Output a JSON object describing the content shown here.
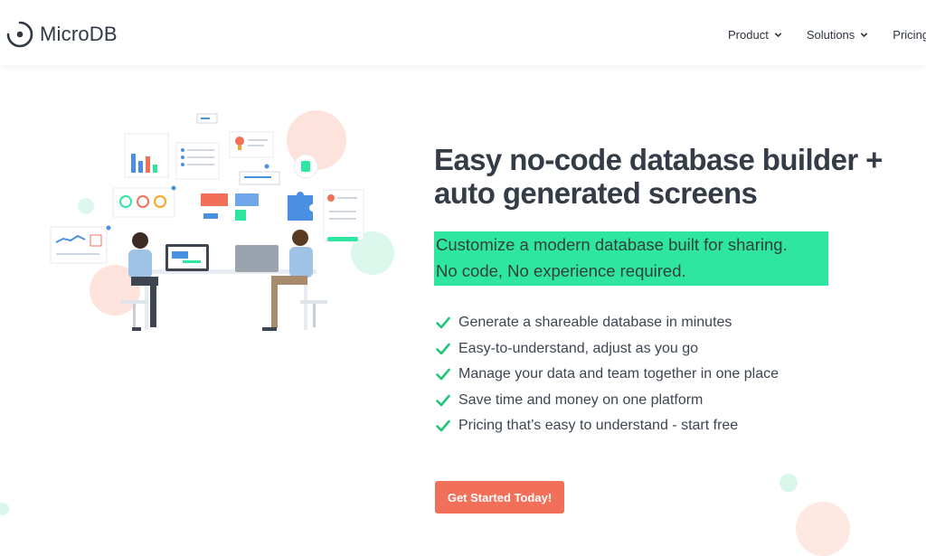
{
  "brand": {
    "name": "MicroDB"
  },
  "nav": {
    "items": [
      {
        "label": "Product"
      },
      {
        "label": "Solutions"
      },
      {
        "label": "Pricing"
      }
    ]
  },
  "hero": {
    "title_line1": "Easy no-code database builder +",
    "title_line2": "auto generated screens",
    "highlight_line1": "Customize a modern database built for sharing.",
    "highlight_line2": "No code, No experience required.",
    "features": [
      "Generate a shareable database in minutes",
      "Easy-to-understand, adjust as you go",
      "Manage your data and team together in one place",
      "Save time and money on one platform",
      "Pricing that’s easy to understand - start free"
    ],
    "cta_label": "Get Started Today!"
  },
  "colors": {
    "accent_green": "#2fe6a1",
    "cta_orange": "#f2705a",
    "check_green": "#21c47b"
  },
  "icons": {
    "logo": "microdb-logo-icon",
    "nav_chevron": "chevron-down-icon",
    "feature_check": "check-icon"
  }
}
